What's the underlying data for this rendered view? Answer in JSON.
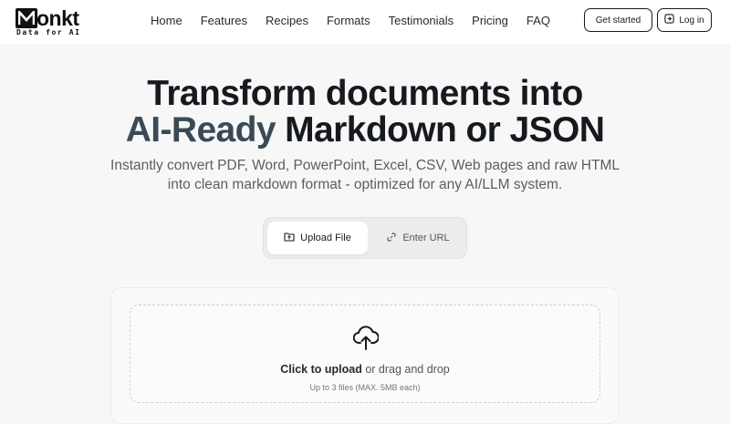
{
  "brand": {
    "name": "onkt",
    "tagline": "Data for AI"
  },
  "nav": {
    "links": [
      "Home",
      "Features",
      "Recipes",
      "Formats",
      "Testimonials",
      "Pricing",
      "FAQ"
    ],
    "get_started": "Get started",
    "login": "Log in"
  },
  "hero": {
    "title_line1": "Transform documents into",
    "title_accent": "AI-Ready",
    "title_line2_rest": " Markdown or JSON",
    "subtitle_line1": "Instantly convert PDF, Word, PowerPoint, Excel, CSV, Web pages and raw HTML",
    "subtitle_line2": "into clean markdown format - optimized for any AI/LLM system."
  },
  "tabs": {
    "upload": "Upload File",
    "url": "Enter URL",
    "active": "upload"
  },
  "upload": {
    "click_text": "Click to upload",
    "drag_text": " or drag and drop",
    "hint": "Up to 3 files (MAX. 5MB each)"
  },
  "icons": {
    "logo": "m-logo-icon",
    "login": "login-icon",
    "upload_tab": "folder-icon",
    "url_tab": "link-icon",
    "dropzone": "cloud-upload-icon"
  },
  "colors": {
    "accent": "#3a4a55",
    "background": "#f7f7f7",
    "text": "#161a1f"
  }
}
